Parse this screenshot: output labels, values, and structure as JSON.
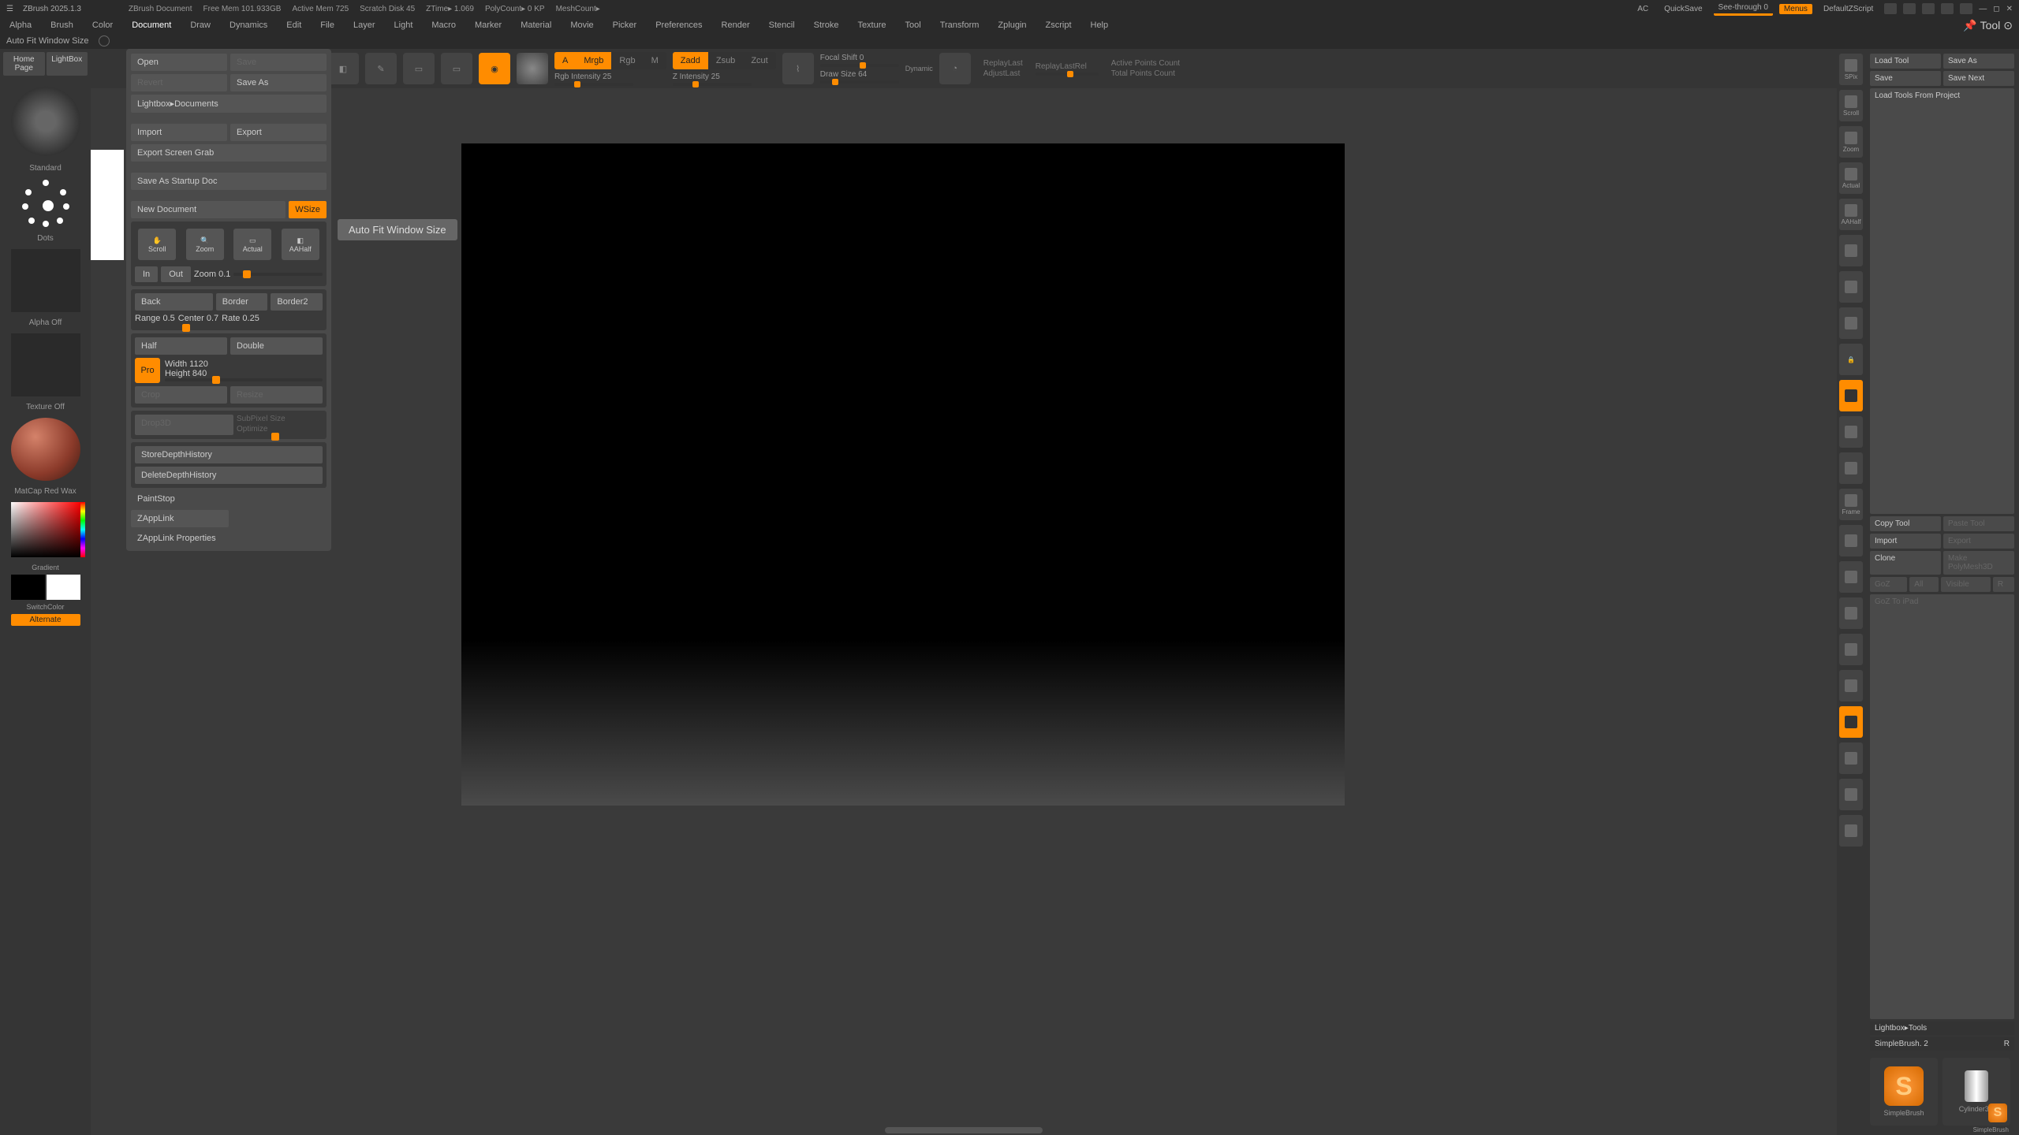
{
  "titlebar": {
    "app": "ZBrush 2025.1.3",
    "doc": "ZBrush Document",
    "stats": [
      "Free Mem 101.933GB",
      "Active Mem 725",
      "Scratch Disk 45",
      "ZTime▸ 1.069",
      "PolyCount▸ 0 KP",
      "MeshCount▸"
    ],
    "ac": "AC",
    "quicksave": "QuickSave",
    "seethrough": "See-through 0",
    "menus": "Menus",
    "script": "DefaultZScript"
  },
  "menubar": {
    "items": [
      "Alpha",
      "Brush",
      "Color",
      "Document",
      "Draw",
      "Dynamics",
      "Edit",
      "File",
      "Layer",
      "Light",
      "Macro",
      "Marker",
      "Material",
      "Movie",
      "Picker",
      "Preferences",
      "Render",
      "Stencil",
      "Stroke",
      "Texture",
      "Tool",
      "Transform",
      "Zplugin",
      "Zscript",
      "Help"
    ],
    "tool_label": "Tool"
  },
  "infobar": {
    "msg": "Auto Fit Window Size"
  },
  "left": {
    "tabs": [
      "Home Page",
      "LightBox"
    ],
    "brush": "Standard",
    "stroke": "Dots",
    "alpha": "Alpha Off",
    "texture": "Texture Off",
    "material": "MatCap Red Wax",
    "gradient": "Gradient",
    "switchcolor": "SwitchColor",
    "alternate": "Alternate"
  },
  "dropdown": {
    "open": "Open",
    "save": "Save",
    "revert": "Revert",
    "saveas": "Save As",
    "lightbox_docs": "Lightbox▸Documents",
    "import": "Import",
    "export": "Export",
    "export_screen": "Export Screen Grab",
    "save_startup": "Save As Startup Doc",
    "newdoc": "New Document",
    "wsize": "WSize",
    "scroll": "Scroll",
    "zoom": "Zoom",
    "actual": "Actual",
    "aahalf": "AAHalf",
    "in": "In",
    "out": "Out",
    "zoom_val": "Zoom 0.1",
    "back": "Back",
    "border": "Border",
    "border2": "Border2",
    "range": "Range 0.5",
    "center": "Center 0.7",
    "rate": "Rate 0.25",
    "half": "Half",
    "double": "Double",
    "pro": "Pro",
    "width": "Width 1120",
    "height": "Height 840",
    "crop": "Crop",
    "resize": "Resize",
    "drop3d": "Drop3D",
    "subpixel": "SubPixel Size",
    "optimize": "Optimize",
    "store_depth": "StoreDepthHistory",
    "delete_depth": "DeleteDepthHistory",
    "paintstop": "PaintStop",
    "zapplink": "ZAppLink",
    "zapplink_props": "ZAppLink Properties",
    "tooltip": "Auto Fit Window Size"
  },
  "toptools": {
    "a": "A",
    "mrgb": "Mrgb",
    "rgb": "Rgb",
    "m": "M",
    "zadd": "Zadd",
    "zsub": "Zsub",
    "zcut": "Zcut",
    "rgb_int": "Rgb Intensity 25",
    "z_int": "Z Intensity 25",
    "focal": "Focal Shift 0",
    "drawsize": "Draw Size 64",
    "dynamic": "Dynamic",
    "replay": "ReplayLast",
    "replayrel": "ReplayLastRel",
    "adjust": "AdjustLast",
    "active_pts": "Active Points Count",
    "total_pts": "Total Points Count"
  },
  "vtool": {
    "items": [
      "SPix",
      "Scroll",
      "Zoom",
      "Actual",
      "AAHalf",
      "",
      "",
      "",
      "",
      "",
      "",
      "",
      "",
      "",
      "",
      "Frame",
      "",
      "",
      "",
      "",
      "",
      "",
      ""
    ]
  },
  "rightpanel": {
    "load_tool": "Load Tool",
    "save_as": "Save As",
    "save": "Save",
    "save_next": "Save Next",
    "load_proj": "Load Tools From Project",
    "copy": "Copy Tool",
    "paste": "Paste Tool",
    "import": "Import",
    "export": "Export",
    "clone": "Clone",
    "makepoly": "Make PolyMesh3D",
    "goz": "GoZ",
    "all": "All",
    "visible": "Visible",
    "r": "R",
    "goz_ipad": "GoZ To iPad",
    "lightbox_tools": "Lightbox▸Tools",
    "simplebrush": "SimpleBrush. 2",
    "r2": "R",
    "tool1": "SimpleBrush",
    "tool2": "Cylinder3D",
    "tool3": "SimpleBrush"
  }
}
